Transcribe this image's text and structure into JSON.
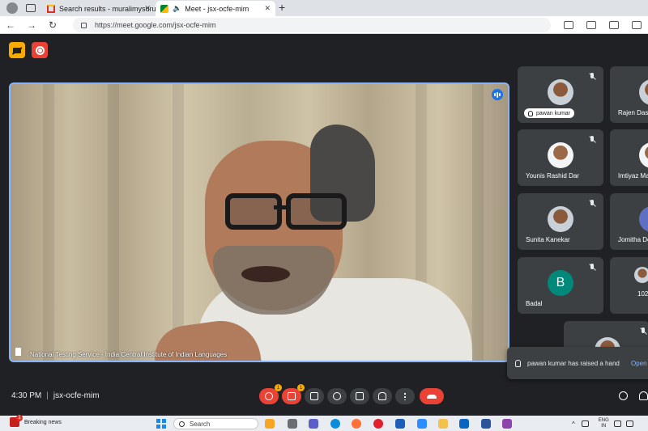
{
  "browser": {
    "tabs": [
      {
        "title": "Search results - muralimysuru@g",
        "active": false
      },
      {
        "title": "Meet - jsx-ocfe-mim",
        "active": true
      }
    ],
    "url": "https://meet.google.com/jsx-ocfe-mim"
  },
  "meeting": {
    "time": "4:30 PM",
    "code": "jsx-ocfe-mim",
    "main_speaker": "National Testing Service - India Central Institute of Indian Languages",
    "participants": [
      {
        "name": "pawan kumar",
        "hand_raised": true
      },
      {
        "name": "Rajen Das"
      },
      {
        "name": "Younis Rashid Dar"
      },
      {
        "name": "Imtiyaz Ma"
      },
      {
        "name": "Sunita Kanekar"
      },
      {
        "name": "Jomitha De"
      },
      {
        "name": "Badal",
        "avatar_letter": "B"
      },
      {
        "name": "102"
      }
    ],
    "toast": {
      "message": "pawan kumar has raised a hand",
      "action": "Open"
    },
    "badges": {
      "mic": "1",
      "cam": "1"
    }
  },
  "taskbar": {
    "news_title": "Breaking news",
    "news_badge": "1",
    "search_placeholder": "Search",
    "lang": "ENG",
    "region": "IN"
  },
  "colors": {
    "accent": "#8ab4f8",
    "danger": "#ea4335",
    "warning": "#f9ab00"
  }
}
